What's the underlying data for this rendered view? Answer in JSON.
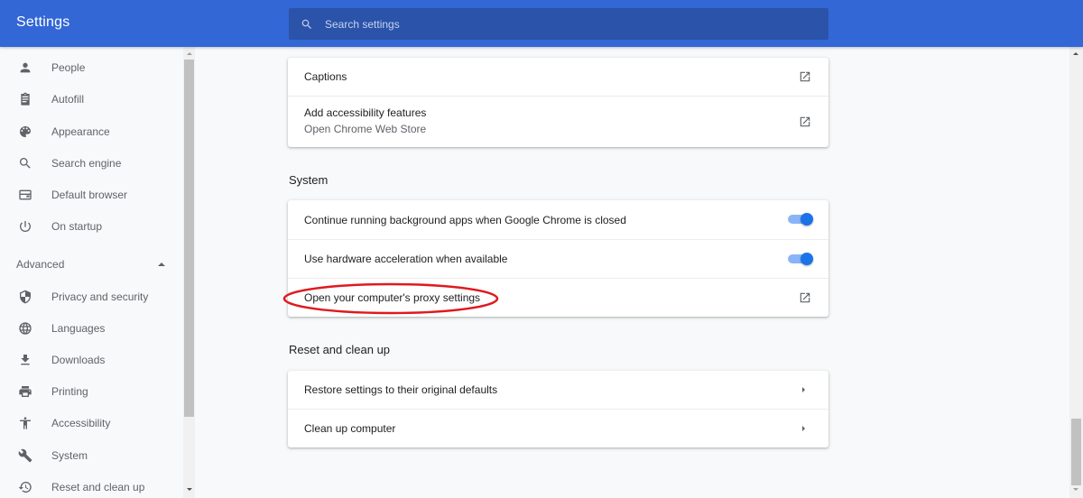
{
  "header": {
    "title": "Settings",
    "search": {
      "placeholder": "Search settings",
      "value": ""
    }
  },
  "sidebar": {
    "items": [
      {
        "label": "People",
        "icon": "person-icon"
      },
      {
        "label": "Autofill",
        "icon": "clipboard-icon"
      },
      {
        "label": "Appearance",
        "icon": "palette-icon"
      },
      {
        "label": "Search engine",
        "icon": "search-icon"
      },
      {
        "label": "Default browser",
        "icon": "browser-icon"
      },
      {
        "label": "On startup",
        "icon": "power-icon"
      }
    ],
    "advanced": {
      "label": "Advanced",
      "expanded": true
    },
    "advanced_items": [
      {
        "label": "Privacy and security",
        "icon": "shield-icon"
      },
      {
        "label": "Languages",
        "icon": "globe-icon"
      },
      {
        "label": "Downloads",
        "icon": "download-icon"
      },
      {
        "label": "Printing",
        "icon": "printer-icon"
      },
      {
        "label": "Accessibility",
        "icon": "accessibility-icon"
      },
      {
        "label": "System",
        "icon": "wrench-icon"
      },
      {
        "label": "Reset and clean up",
        "icon": "history-icon"
      }
    ]
  },
  "main": {
    "accessibility_card": {
      "rows": [
        {
          "label": "Captions",
          "action": "external-link-icon"
        },
        {
          "label": "Add accessibility features",
          "sublabel": "Open Chrome Web Store",
          "action": "external-link-icon"
        }
      ]
    },
    "system": {
      "title": "System",
      "rows": [
        {
          "label": "Continue running background apps when Google Chrome is closed",
          "toggle": true
        },
        {
          "label": "Use hardware acceleration when available",
          "toggle": true
        },
        {
          "label": "Open your computer's proxy settings",
          "action": "external-link-icon",
          "highlighted": true
        }
      ]
    },
    "reset": {
      "title": "Reset and clean up",
      "rows": [
        {
          "label": "Restore settings to their original defaults",
          "action": "chevron-right-icon"
        },
        {
          "label": "Clean up computer",
          "action": "chevron-right-icon"
        }
      ]
    }
  },
  "colors": {
    "header_bg": "#3367d6",
    "search_bg": "#2a53a9",
    "toggle_on": "#1a73e8",
    "highlight_annotation": "#e0191e"
  }
}
